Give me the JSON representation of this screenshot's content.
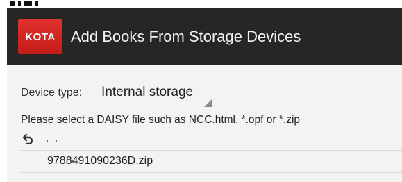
{
  "app": {
    "logo_text": "KOTA",
    "logo_color": "#d42622",
    "title": "Add Books From Storage Devices",
    "appbar_color": "#262626"
  },
  "device": {
    "label": "Device type:",
    "selected": "Internal storage"
  },
  "instruction": "Please select a DAISY file such as NCC.html, *.opf or *.zip",
  "parent_entry": {
    "icon": "back-arrow-icon",
    "label": ". ."
  },
  "files": [
    {
      "name": "9788491090236D.zip"
    }
  ]
}
